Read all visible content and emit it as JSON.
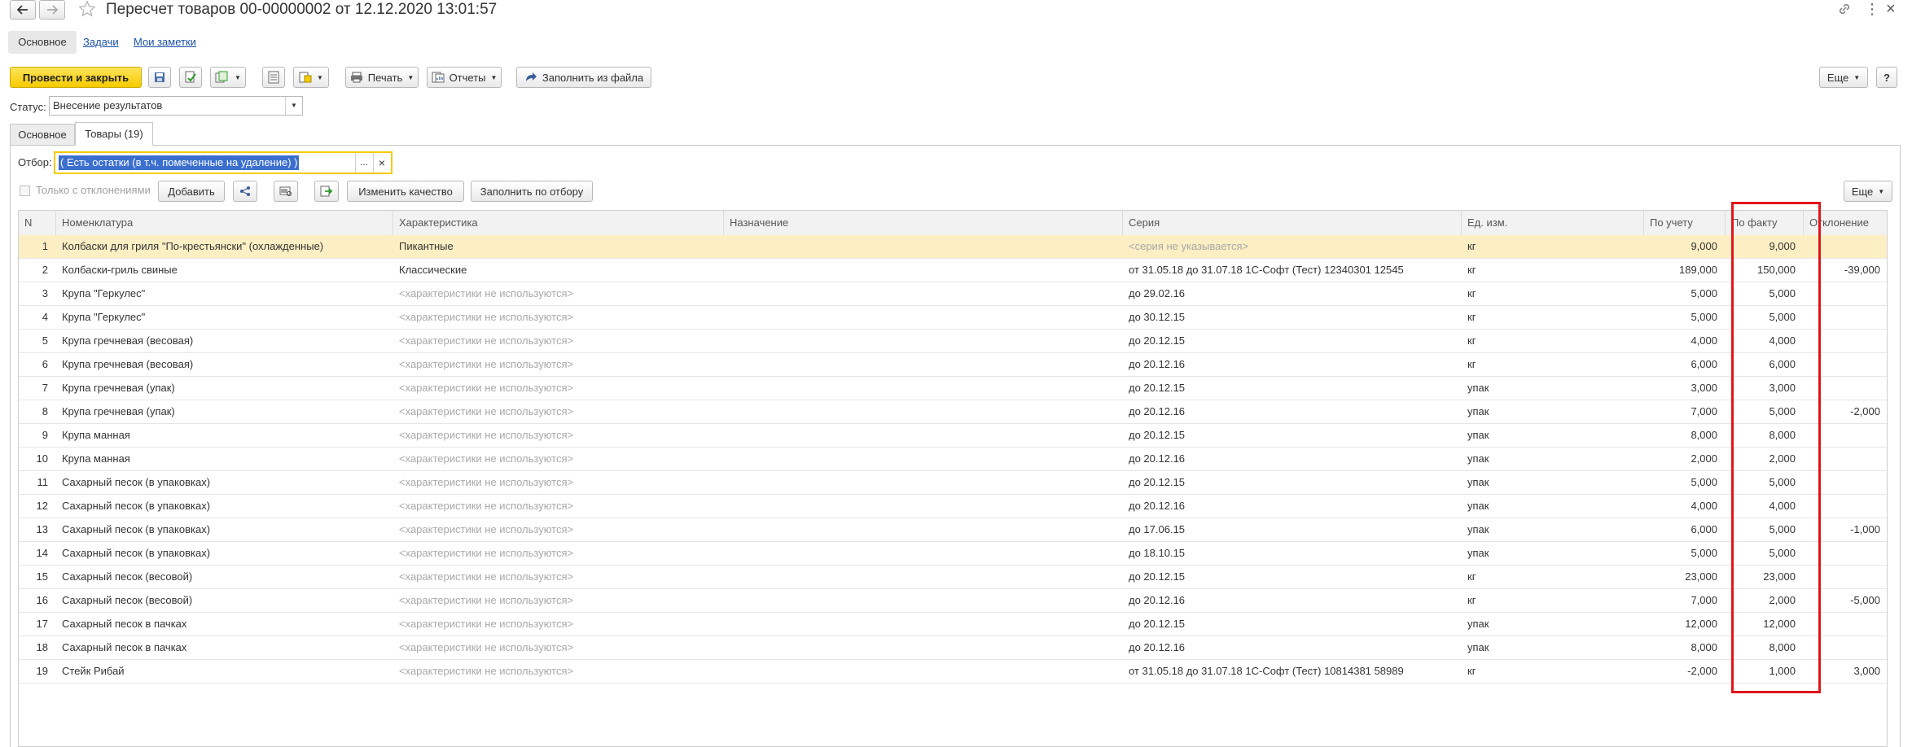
{
  "window": {
    "title": "Пересчет товаров 00-00000002 от 12.12.2020 13:01:57"
  },
  "nav_tabs": [
    "Основное",
    "Задачи",
    "Мои заметки"
  ],
  "toolbar": {
    "post_close": "Провести и закрыть",
    "print": "Печать",
    "reports": "Отчеты",
    "fill_from_file": "Заполнить из файла",
    "more": "Еще",
    "help": "?"
  },
  "status": {
    "label": "Статус:",
    "value": "Внесение результатов"
  },
  "doc_tabs": [
    "Основное",
    "Товары (19)"
  ],
  "filter": {
    "label": "Отбор:",
    "value": "( Есть остатки (в т.ч. помеченные на удаление) )",
    "dots": "...",
    "clear": "×"
  },
  "table_toolbar": {
    "only_deviations": "Только с отклонениями",
    "add": "Добавить",
    "change_quality": "Изменить качество",
    "fill_by_filter": "Заполнить по отбору",
    "more": "Еще"
  },
  "columns": [
    "N",
    "Номенклатура",
    "Характеристика",
    "Назначение",
    "Серия",
    "Ед. изм.",
    "По учету",
    "По факту",
    "Отклонение"
  ],
  "rows": [
    {
      "n": "1",
      "item": "Колбаски для гриля \"По-крестьянски\" (охлажденные)",
      "char": "Пикантные",
      "series": "<серия не указывается>",
      "unit": "кг",
      "book": "9,000",
      "fact": "9,000",
      "dev": ""
    },
    {
      "n": "2",
      "item": "Колбаски-гриль свиные",
      "char": "Классические",
      "series": "от 31.05.18 до 31.07.18 1С-Софт (Тест) 12340301 12545",
      "unit": "кг",
      "book": "189,000",
      "fact": "150,000",
      "dev": "-39,000"
    },
    {
      "n": "3",
      "item": "Крупа \"Геркулес\"",
      "char": "<характеристики не используются>",
      "series": "до 29.02.16",
      "unit": "кг",
      "book": "5,000",
      "fact": "5,000",
      "dev": ""
    },
    {
      "n": "4",
      "item": "Крупа \"Геркулес\"",
      "char": "<характеристики не используются>",
      "series": "до 30.12.15",
      "unit": "кг",
      "book": "5,000",
      "fact": "5,000",
      "dev": ""
    },
    {
      "n": "5",
      "item": "Крупа гречневая (весовая)",
      "char": "<характеристики не используются>",
      "series": "до 20.12.15",
      "unit": "кг",
      "book": "4,000",
      "fact": "4,000",
      "dev": ""
    },
    {
      "n": "6",
      "item": "Крупа гречневая (весовая)",
      "char": "<характеристики не используются>",
      "series": "до 20.12.16",
      "unit": "кг",
      "book": "6,000",
      "fact": "6,000",
      "dev": ""
    },
    {
      "n": "7",
      "item": "Крупа гречневая (упак)",
      "char": "<характеристики не используются>",
      "series": "до 20.12.15",
      "unit": "упак",
      "book": "3,000",
      "fact": "3,000",
      "dev": ""
    },
    {
      "n": "8",
      "item": "Крупа гречневая (упак)",
      "char": "<характеристики не используются>",
      "series": "до 20.12.16",
      "unit": "упак",
      "book": "7,000",
      "fact": "5,000",
      "dev": "-2,000"
    },
    {
      "n": "9",
      "item": "Крупа манная",
      "char": "<характеристики не используются>",
      "series": "до 20.12.15",
      "unit": "упак",
      "book": "8,000",
      "fact": "8,000",
      "dev": ""
    },
    {
      "n": "10",
      "item": "Крупа манная",
      "char": "<характеристики не используются>",
      "series": "до 20.12.16",
      "unit": "упак",
      "book": "2,000",
      "fact": "2,000",
      "dev": ""
    },
    {
      "n": "11",
      "item": "Сахарный песок (в упаковках)",
      "char": "<характеристики не используются>",
      "series": "до 20.12.15",
      "unit": "упак",
      "book": "5,000",
      "fact": "5,000",
      "dev": ""
    },
    {
      "n": "12",
      "item": "Сахарный песок (в упаковках)",
      "char": "<характеристики не используются>",
      "series": "до 20.12.16",
      "unit": "упак",
      "book": "4,000",
      "fact": "4,000",
      "dev": ""
    },
    {
      "n": "13",
      "item": "Сахарный песок (в упаковках)",
      "char": "<характеристики не используются>",
      "series": "до 17.06.15",
      "unit": "упак",
      "book": "6,000",
      "fact": "5,000",
      "dev": "-1,000"
    },
    {
      "n": "14",
      "item": "Сахарный песок (в упаковках)",
      "char": "<характеристики не используются>",
      "series": "до 18.10.15",
      "unit": "упак",
      "book": "5,000",
      "fact": "5,000",
      "dev": ""
    },
    {
      "n": "15",
      "item": "Сахарный песок (весовой)",
      "char": "<характеристики не используются>",
      "series": "до 20.12.15",
      "unit": "кг",
      "book": "23,000",
      "fact": "23,000",
      "dev": ""
    },
    {
      "n": "16",
      "item": "Сахарный песок (весовой)",
      "char": "<характеристики не используются>",
      "series": "до 20.12.16",
      "unit": "кг",
      "book": "7,000",
      "fact": "2,000",
      "dev": "-5,000"
    },
    {
      "n": "17",
      "item": "Сахарный песок в пачках",
      "char": "<характеристики не используются>",
      "series": "до 20.12.15",
      "unit": "упак",
      "book": "12,000",
      "fact": "12,000",
      "dev": ""
    },
    {
      "n": "18",
      "item": "Сахарный песок в пачках",
      "char": "<характеристики не используются>",
      "series": "до 20.12.16",
      "unit": "упак",
      "book": "8,000",
      "fact": "8,000",
      "dev": ""
    },
    {
      "n": "19",
      "item": "Стейк Рибай",
      "char": "<характеристики не используются>",
      "series": "от 31.05.18 до 31.07.18 1С-Софт (Тест) 10814381 58989",
      "unit": "кг",
      "book": "-2,000",
      "fact": "1,000",
      "dev": "3,000"
    }
  ],
  "colors": {
    "accent_yellow": "#f5cb00",
    "selected_row": "#fcefc4",
    "highlight_red": "#e0161b",
    "filter_selection": "#3b6fcf"
  }
}
